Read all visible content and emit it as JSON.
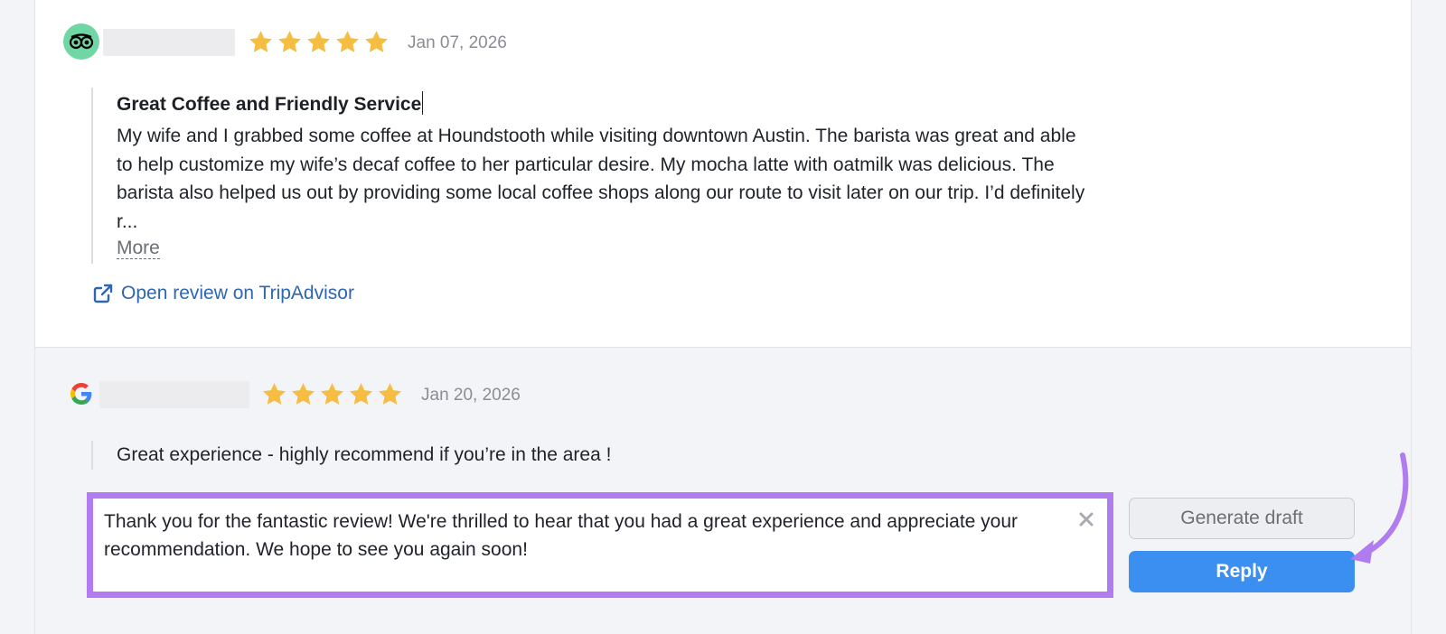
{
  "colors": {
    "star": "#f5bd41",
    "link": "#2f66b3",
    "highlight_border": "#b07cf0",
    "primary_button": "#3a8ff0",
    "tripadvisor_badge": "#6fd6a4"
  },
  "reviews": [
    {
      "source_icon": "tripadvisor-icon",
      "rating": 5,
      "date": "Jan 07, 2026",
      "title": "Great Coffee and Friendly Service",
      "text": "My wife and I grabbed some coffee at Houndstooth while visiting downtown Austin. The barista was great and able to help customize my wife’s decaf coffee to her particular desire. My mocha latte with oatmilk was delicious. The barista also helped us out by providing some local coffee shops along our route to visit later on our trip. I’d definitely r...",
      "more_label": "More",
      "open_link_label": "Open review on TripAdvisor"
    },
    {
      "source_icon": "google-icon",
      "rating": 5,
      "date": "Jan 20, 2026",
      "text": "Great experience - highly recommend if you’re in the area !"
    }
  ],
  "reply": {
    "text": "Thank you for the fantastic review! We're thrilled to hear that you had a great experience and appreciate your recommendation. We hope to see you again soon!",
    "generate_draft_label": "Generate draft",
    "reply_label": "Reply"
  }
}
